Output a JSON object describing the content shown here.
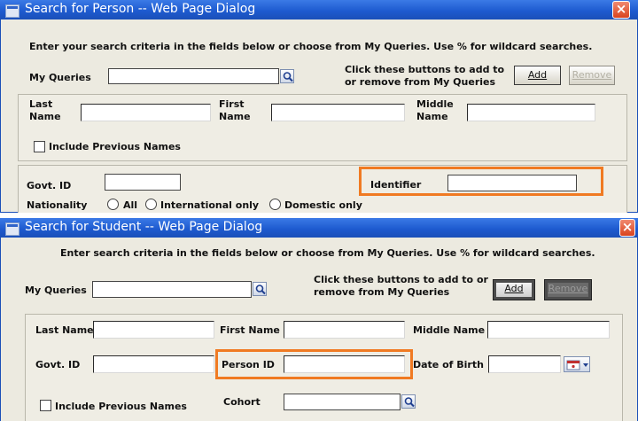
{
  "person_dialog": {
    "title": "Search for Person -- Web Page Dialog",
    "close_glyph": "×",
    "instructions": "Enter your search criteria in the fields below or choose from My Queries. Use % for wildcard searches.",
    "my_queries_label": "My Queries",
    "my_queries_value": "",
    "buttons_hint_1": "Click these buttons to add to",
    "buttons_hint_2": "or remove from My Queries",
    "add_label": "Add",
    "remove_label": "Remove",
    "last_name_label_1": "Last",
    "last_name_label_2": "Name",
    "first_name_label_1": "First",
    "first_name_label_2": "Name",
    "middle_name_label_1": "Middle",
    "middle_name_label_2": "Name",
    "include_previous_label": "Include Previous Names",
    "govt_id_label": "Govt. ID",
    "identifier_label": "Identifier",
    "nationality_label": "Nationality",
    "nationality_options": [
      "All",
      "International only",
      "Domestic only"
    ]
  },
  "student_dialog": {
    "title": "Search for Student -- Web Page Dialog",
    "close_glyph": "×",
    "instructions": "Enter search criteria in the fields below or choose from My Queries. Use % for wildcard searches.",
    "my_queries_label": "My Queries",
    "buttons_hint_1": "Click these buttons to add to or",
    "buttons_hint_2": "remove from My Queries",
    "add_label": "Add",
    "remove_label": "Remove",
    "last_name_label": "Last Name",
    "first_name_label": "First Name",
    "middle_name_label": "Middle Name",
    "govt_id_label": "Govt. ID",
    "person_id_label": "Person ID",
    "dob_label": "Date of Birth",
    "include_previous_label": "Include Previous Names",
    "cohort_label": "Cohort"
  },
  "colors": {
    "highlight": "#f07a22",
    "titlebar": "#1e5bd0",
    "dialog_bg": "#eceae0"
  }
}
